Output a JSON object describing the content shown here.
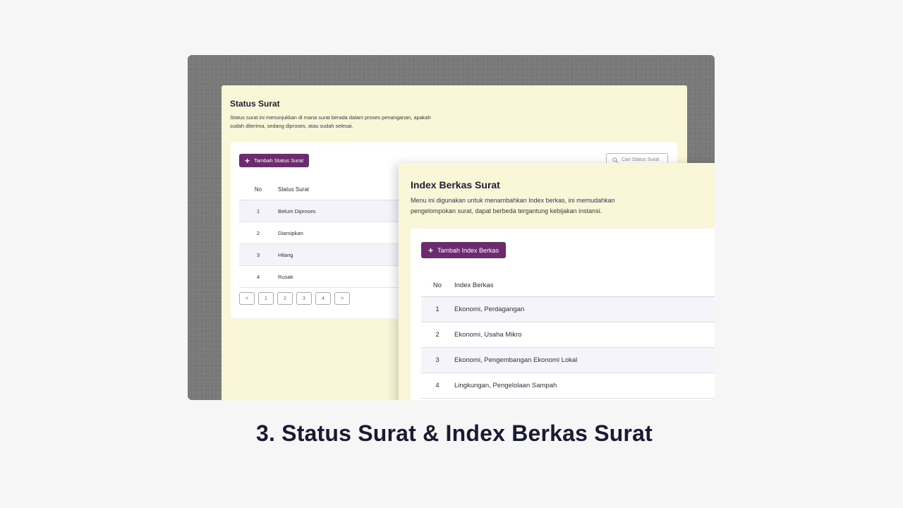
{
  "status_panel": {
    "title": "Status Surat",
    "description": "Status surat ini menunjukkan di mana surat berada dalam proses penanganan, apakah sudah diterima, sedang diproses, atau sudah selesai.",
    "add_button_label": "Tambah Status Surat",
    "search_placeholder": "Cari Status Surat",
    "columns": {
      "no": "No",
      "name": "Status Surat"
    },
    "rows": [
      {
        "no": "1",
        "name": "Belum Diproses"
      },
      {
        "no": "2",
        "name": "Diarsipkan"
      },
      {
        "no": "3",
        "name": "Hilang"
      },
      {
        "no": "4",
        "name": "Rusak"
      }
    ],
    "pagination": {
      "prev": "<",
      "pages": [
        "1",
        "2",
        "3",
        "4"
      ],
      "next": ">"
    }
  },
  "index_panel": {
    "title": "Index Berkas Surat",
    "description": "Menu ini digunakan untuk menambahkan Index berkas, ini memudahkan pengelompokan surat, dapat berbeda tergantung kebijakan instansi.",
    "add_button_label": "Tambah Index Berkas",
    "columns": {
      "no": "No",
      "name": "Index Berkas"
    },
    "rows": [
      {
        "no": "1",
        "name": "Ekonomi, Perdagangan"
      },
      {
        "no": "2",
        "name": "Ekonomi, Usaha Mikro"
      },
      {
        "no": "3",
        "name": "Ekonomi, Pengembangan Ekonomi Lokal"
      },
      {
        "no": "4",
        "name": "Lingkungan, Pengelolaan Sampah"
      }
    ]
  },
  "caption": "3. Status Surat & Index Berkas Surat",
  "colors": {
    "primary": "#6c2b6e",
    "panel_bg": "#faf6d8",
    "page_bg": "#f6f6f7",
    "frame_bg": "#7a7a7a"
  }
}
